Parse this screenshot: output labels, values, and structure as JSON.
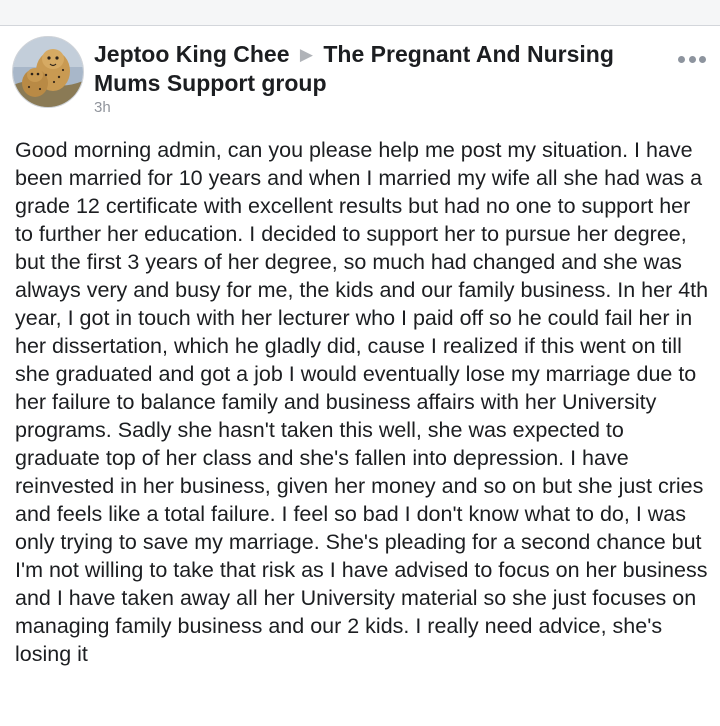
{
  "post": {
    "author": "Jeptoo King Chee",
    "group": "The Pregnant And Nursing Mums Support group",
    "timestamp": "3h",
    "body": "Good morning admin, can you please help me post my situation. I have been married for 10 years and when I married my wife all she had was a grade 12 certificate with excellent results but had no one to support her to further her education. I decided to support her to pursue her degree, but the first 3 years of her degree, so much had changed and she was always very and busy for me, the kids and our family business. In her 4th year, I got in touch with her lecturer who I paid off so he could fail her in her dissertation, which he gladly did, cause I realized if this went on till she graduated and got a job I would eventually lose my marriage due to her failure to balance family and business affairs with her University programs. Sadly she hasn't taken this well, she was expected to graduate top of her class and she's fallen into depression. I have reinvested in her business, given her money and so on but she just cries and feels like a total failure. I feel so bad I don't know what to do, I was only trying to save my marriage. She's pleading for a second chance but I'm not willing to take that risk as I have advised to focus on her business and I have taken away all her University material so she just focuses on managing family business and our 2 kids. I really need advice, she's losing it"
  },
  "icons": {
    "avatar": "cheetah-profile-photo",
    "arrow": "right-triangle-icon",
    "more": "more-options-icon"
  },
  "colors": {
    "author_text": "#1c1e21",
    "meta_text": "#90949c",
    "arrow": "#b0b3b8",
    "divider_bg": "#f5f6f7"
  }
}
